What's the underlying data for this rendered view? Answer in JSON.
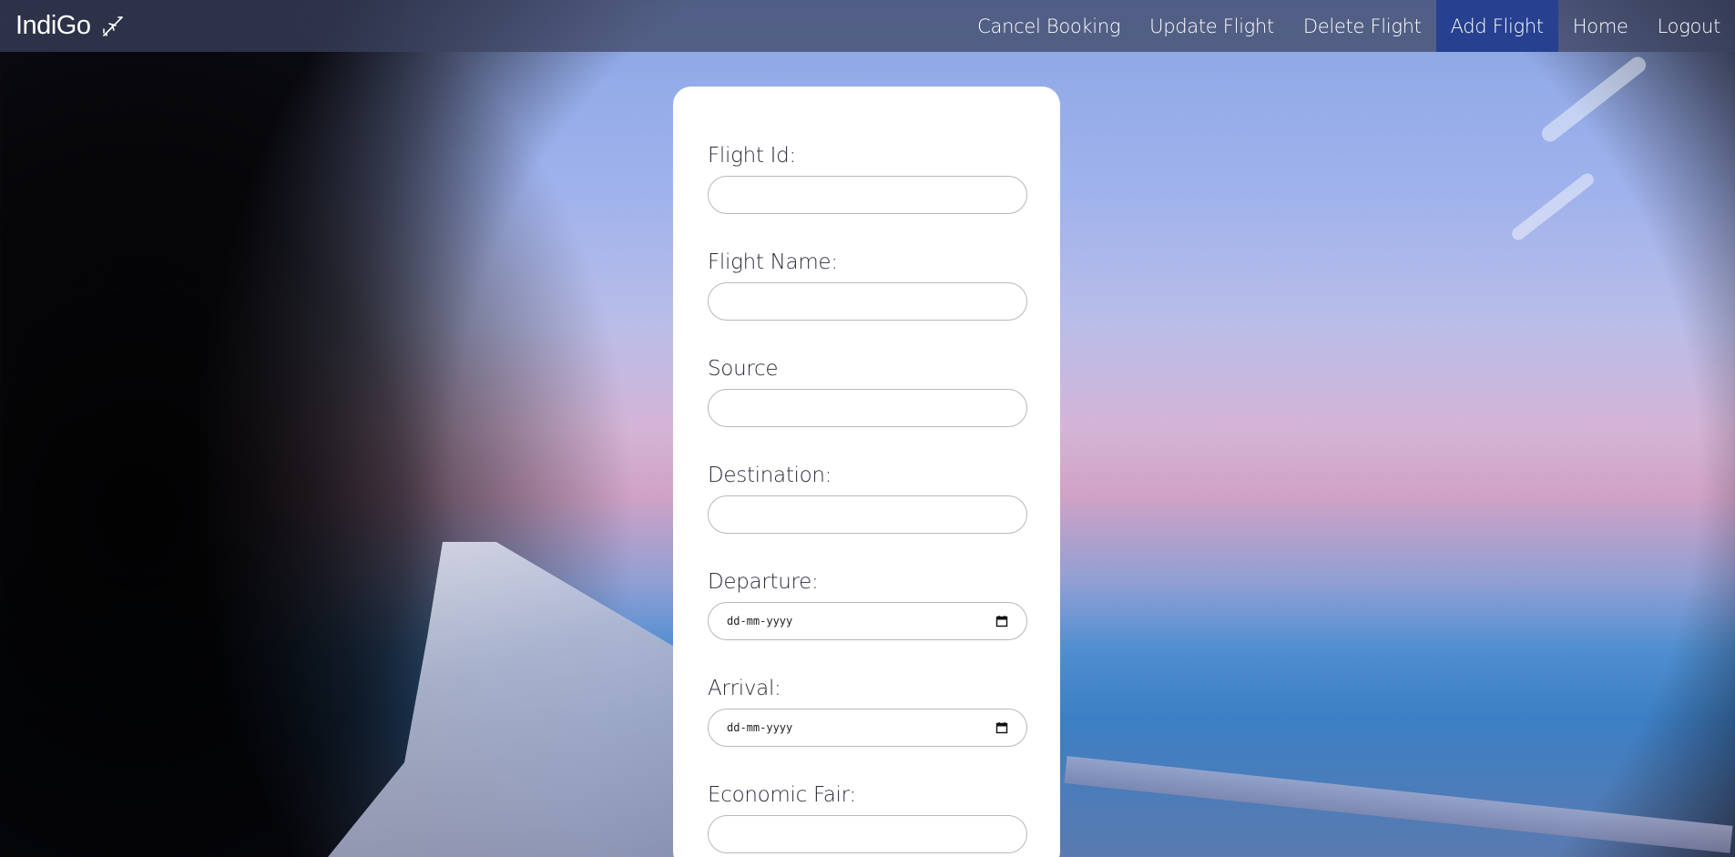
{
  "brand": {
    "name": "IndiGo",
    "icon": "plane-icon"
  },
  "nav": {
    "items": [
      {
        "label": "Cancel Booking"
      },
      {
        "label": "Update Flight"
      },
      {
        "label": "Delete Flight"
      },
      {
        "label": "Add Flight",
        "active": true
      },
      {
        "label": "Home"
      },
      {
        "label": "Logout"
      }
    ],
    "active_color": "#27408f"
  },
  "form": {
    "fields": [
      {
        "label": "Flight Id:",
        "type": "text",
        "value": ""
      },
      {
        "label": "Flight Name:",
        "type": "text",
        "value": ""
      },
      {
        "label": "Source",
        "type": "text",
        "value": ""
      },
      {
        "label": "Destination:",
        "type": "text",
        "value": ""
      },
      {
        "label": "Departure:",
        "type": "date",
        "placeholder": "dd-mm-yyyy"
      },
      {
        "label": "Arrival:",
        "type": "date",
        "placeholder": "dd-mm-yyyy"
      },
      {
        "label": "Economic Fair:",
        "type": "text",
        "value": ""
      }
    ]
  }
}
